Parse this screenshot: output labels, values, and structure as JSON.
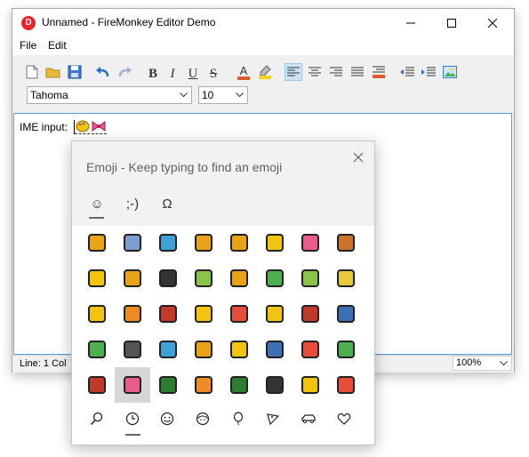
{
  "window": {
    "title": "Unnamed - FireMonkey Editor Demo",
    "app_icon_letter": "D"
  },
  "menu": [
    "File",
    "Edit"
  ],
  "toolbar": {
    "font_name": "Tahoma",
    "font_size": "10",
    "bold": "B",
    "italic": "I",
    "underline": "U",
    "strike": "S",
    "font_color": "A"
  },
  "editor": {
    "text": "IME input:"
  },
  "status": {
    "line": "Line: 1 Col",
    "zoom": "100%"
  },
  "emoji_panel": {
    "title": "Emoji - Keep typing to find an emoji",
    "tabs": [
      "☺",
      ";-)",
      "Ω"
    ],
    "grid": [
      [
        "#e8a317",
        "#7a9fcf",
        "#3fa0d8",
        "#e8a317",
        "#e8a317",
        "#f2c40f",
        "#e85c8c",
        "#c9742a"
      ],
      [
        "#f2c40f",
        "#e8a317",
        "#333333",
        "#8bc34a",
        "#e8a317",
        "#4caf50",
        "#8bc34a",
        "#e8c93a"
      ],
      [
        "#f2c40f",
        "#f08a24",
        "#c0392b",
        "#f2c40f",
        "#e74c3c",
        "#f2c40f",
        "#c0392b",
        "#3d6fb5"
      ],
      [
        "#4caf50",
        "#555555",
        "#3fa0d8",
        "#e8a317",
        "#f2c40f",
        "#3d6fb5",
        "#e74c3c",
        "#4caf50"
      ],
      [
        "#c0392b",
        "#e85c8c",
        "#2e7d32",
        "#f08a24",
        "#2e7d32",
        "#333333",
        "#f2c40f",
        "#e74c3c"
      ]
    ],
    "selected": [
      4,
      1
    ],
    "categories": [
      "magnifier-icon",
      "recent-icon",
      "smiley-icon",
      "people-icon",
      "balloon-icon",
      "food-icon",
      "car-icon",
      "heart-icon"
    ]
  }
}
